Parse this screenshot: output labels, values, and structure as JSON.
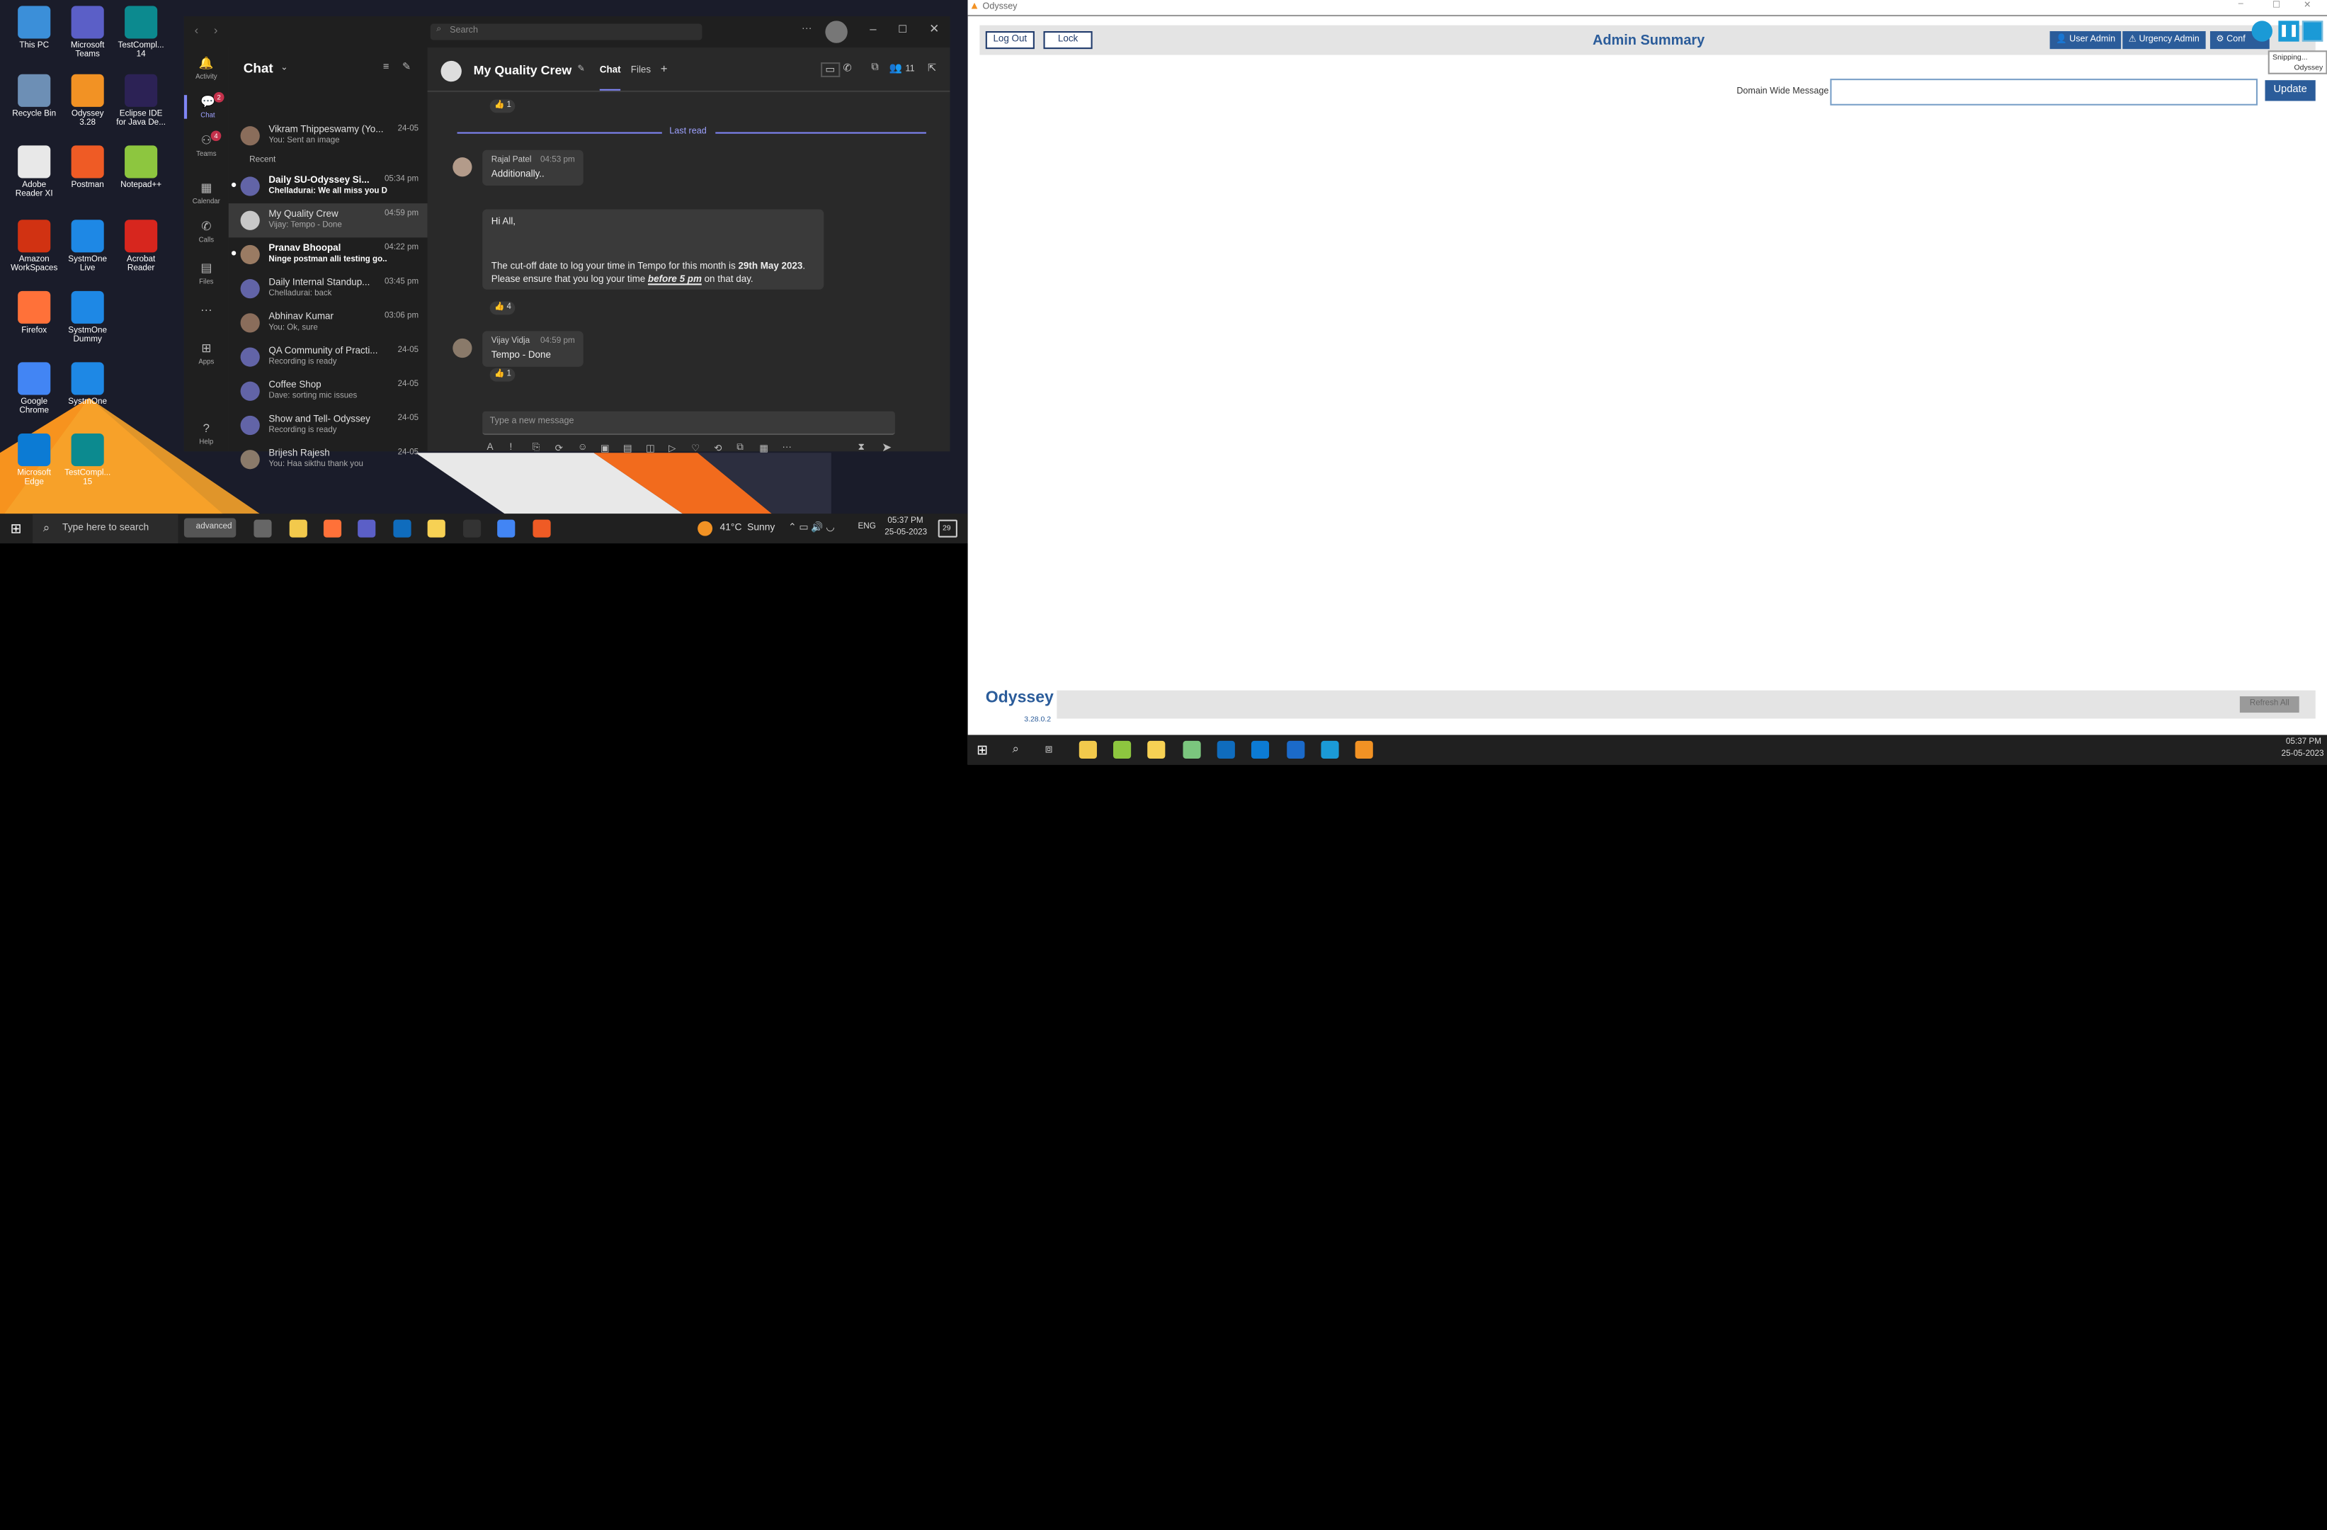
{
  "desktop": {
    "icons": [
      {
        "label": "This PC",
        "icon": "computer-icon",
        "color": "#3b8fd9"
      },
      {
        "label": "Microsoft Teams",
        "icon": "teams-icon",
        "color": "#5b5fc7"
      },
      {
        "label": "TestCompl... 14",
        "icon": "testcomplete-icon",
        "color": "#0c8a8f"
      },
      {
        "label": "Recycle Bin",
        "icon": "recycle-bin-icon",
        "color": "#6d8fb5"
      },
      {
        "label": "Odyssey 3.28",
        "icon": "odyssey-icon",
        "color": "#f29224"
      },
      {
        "label": "Eclipse IDE for Java De...",
        "icon": "eclipse-icon",
        "color": "#2c2255"
      },
      {
        "label": "Adobe Reader XI",
        "icon": "document-icon",
        "color": "#e8e8e8"
      },
      {
        "label": "Postman",
        "icon": "postman-icon",
        "color": "#ef5b25"
      },
      {
        "label": "Notepad++",
        "icon": "notepad-icon",
        "color": "#8dc63f"
      },
      {
        "label": "Amazon WorkSpaces",
        "icon": "workspaces-icon",
        "color": "#d13212"
      },
      {
        "label": "SystmOne Live",
        "icon": "systmone-icon",
        "color": "#1e88e5"
      },
      {
        "label": "Acrobat Reader",
        "icon": "acrobat-icon",
        "color": "#d7261e"
      },
      {
        "label": "Firefox",
        "icon": "firefox-icon",
        "color": "#ff7139"
      },
      {
        "label": "SystmOne Dummy",
        "icon": "systmone-icon",
        "color": "#1e88e5"
      },
      {
        "label": "Google Chrome",
        "icon": "chrome-icon",
        "color": "#4285f4"
      },
      {
        "label": "SystmOne",
        "icon": "systmone-icon",
        "color": "#1e88e5"
      },
      {
        "label": "Microsoft Edge",
        "icon": "edge-icon",
        "color": "#0c7bd4"
      },
      {
        "label": "TestCompl... 15",
        "icon": "testcomplete-icon",
        "color": "#0c8a8f"
      }
    ]
  },
  "teams": {
    "search_placeholder": "Search",
    "rail": [
      {
        "label": "Activity",
        "icon": "bell-icon"
      },
      {
        "label": "Chat",
        "icon": "chat-icon",
        "badge": "2"
      },
      {
        "label": "Teams",
        "icon": "teams-icon",
        "badge": "4"
      },
      {
        "label": "Calendar",
        "icon": "calendar-icon"
      },
      {
        "label": "Calls",
        "icon": "phone-icon"
      },
      {
        "label": "Files",
        "icon": "file-icon"
      },
      {
        "label": "...",
        "icon": "more-icon"
      },
      {
        "label": "Apps",
        "icon": "apps-icon"
      },
      {
        "label": "Help",
        "icon": "help-icon"
      }
    ],
    "chat_title": "Chat",
    "recent_label": "Recent",
    "pinned": {
      "name": "Vikram Thippeswamy (Yo...",
      "preview": "You: Sent an image",
      "time": "24-05"
    },
    "chats": [
      {
        "name": "Daily SU-Odyssey Si...",
        "preview": "Chelladurai: We all miss you D...",
        "time": "05:34 pm",
        "bold": true
      },
      {
        "name": "My Quality Crew",
        "preview": "Vijay: Tempo - Done",
        "time": "04:59 pm",
        "selected": true
      },
      {
        "name": "Pranav Bhoopal",
        "preview": "Ninge postman alli testing go...",
        "time": "04:22 pm",
        "bold": true
      },
      {
        "name": "Daily Internal Standup...",
        "preview": "Chelladurai: back",
        "time": "03:45 pm"
      },
      {
        "name": "Abhinav Kumar",
        "preview": "You: Ok, sure",
        "time": "03:06 pm"
      },
      {
        "name": "QA Community of Practi...",
        "preview": "Recording is ready",
        "time": "24-05"
      },
      {
        "name": "Coffee Shop",
        "preview": "Dave: sorting mic issues",
        "time": "24-05"
      },
      {
        "name": "Show and Tell- Odyssey",
        "preview": "Recording is ready",
        "time": "24-05"
      },
      {
        "name": "Brijesh Rajesh",
        "preview": "You: Haa sikthu thank you",
        "time": "24-05"
      }
    ],
    "conversation": {
      "title": "My Quality Crew",
      "tab_chat": "Chat",
      "tab_files": "Files",
      "participants": "11",
      "top_reaction": "1",
      "last_read": "Last read",
      "msg1": {
        "sender": "Rajal Patel",
        "time": "04:53 pm",
        "text": "Additionally.."
      },
      "msg2": {
        "hi": "Hi All,",
        "line1_pre": "The cut-off date to log your time in Tempo for this month is ",
        "line1_bold": "29th May 2023",
        "line1_post": ". Please ensure that you log your time ",
        "emph": "before 5 pm",
        "line1_end": " on that day.",
        "reaction": "4"
      },
      "msg3": {
        "sender": "Vijay Vidja",
        "time": "04:59 pm",
        "text": "Tempo - Done",
        "reaction": "1"
      },
      "compose_placeholder": "Type a new message"
    }
  },
  "taskbar_left": {
    "search_placeholder": "Type here to search",
    "pill": "advanced",
    "weather": "41°C  Sunny",
    "lang": "ENG",
    "time": "05:37 PM",
    "date": "25-05-2023",
    "notif": "29"
  },
  "odyssey": {
    "window_title": "Odyssey",
    "logout": "Log Out",
    "lock": "Lock",
    "page_title": "Admin Summary",
    "user_admin": "User Admin",
    "urgency_admin": "Urgency Admin",
    "config": "Conf",
    "tooltip1": "Snipping...",
    "tooltip2": "Odyssey",
    "domain_label": "Domain Wide Message",
    "domain_value": "",
    "update": "Update",
    "brand": "Odyssey",
    "version": "3.28.0.2",
    "refresh": "Refresh All"
  },
  "taskbar_right": {
    "time": "05:37 PM",
    "date": "25-05-2023"
  }
}
